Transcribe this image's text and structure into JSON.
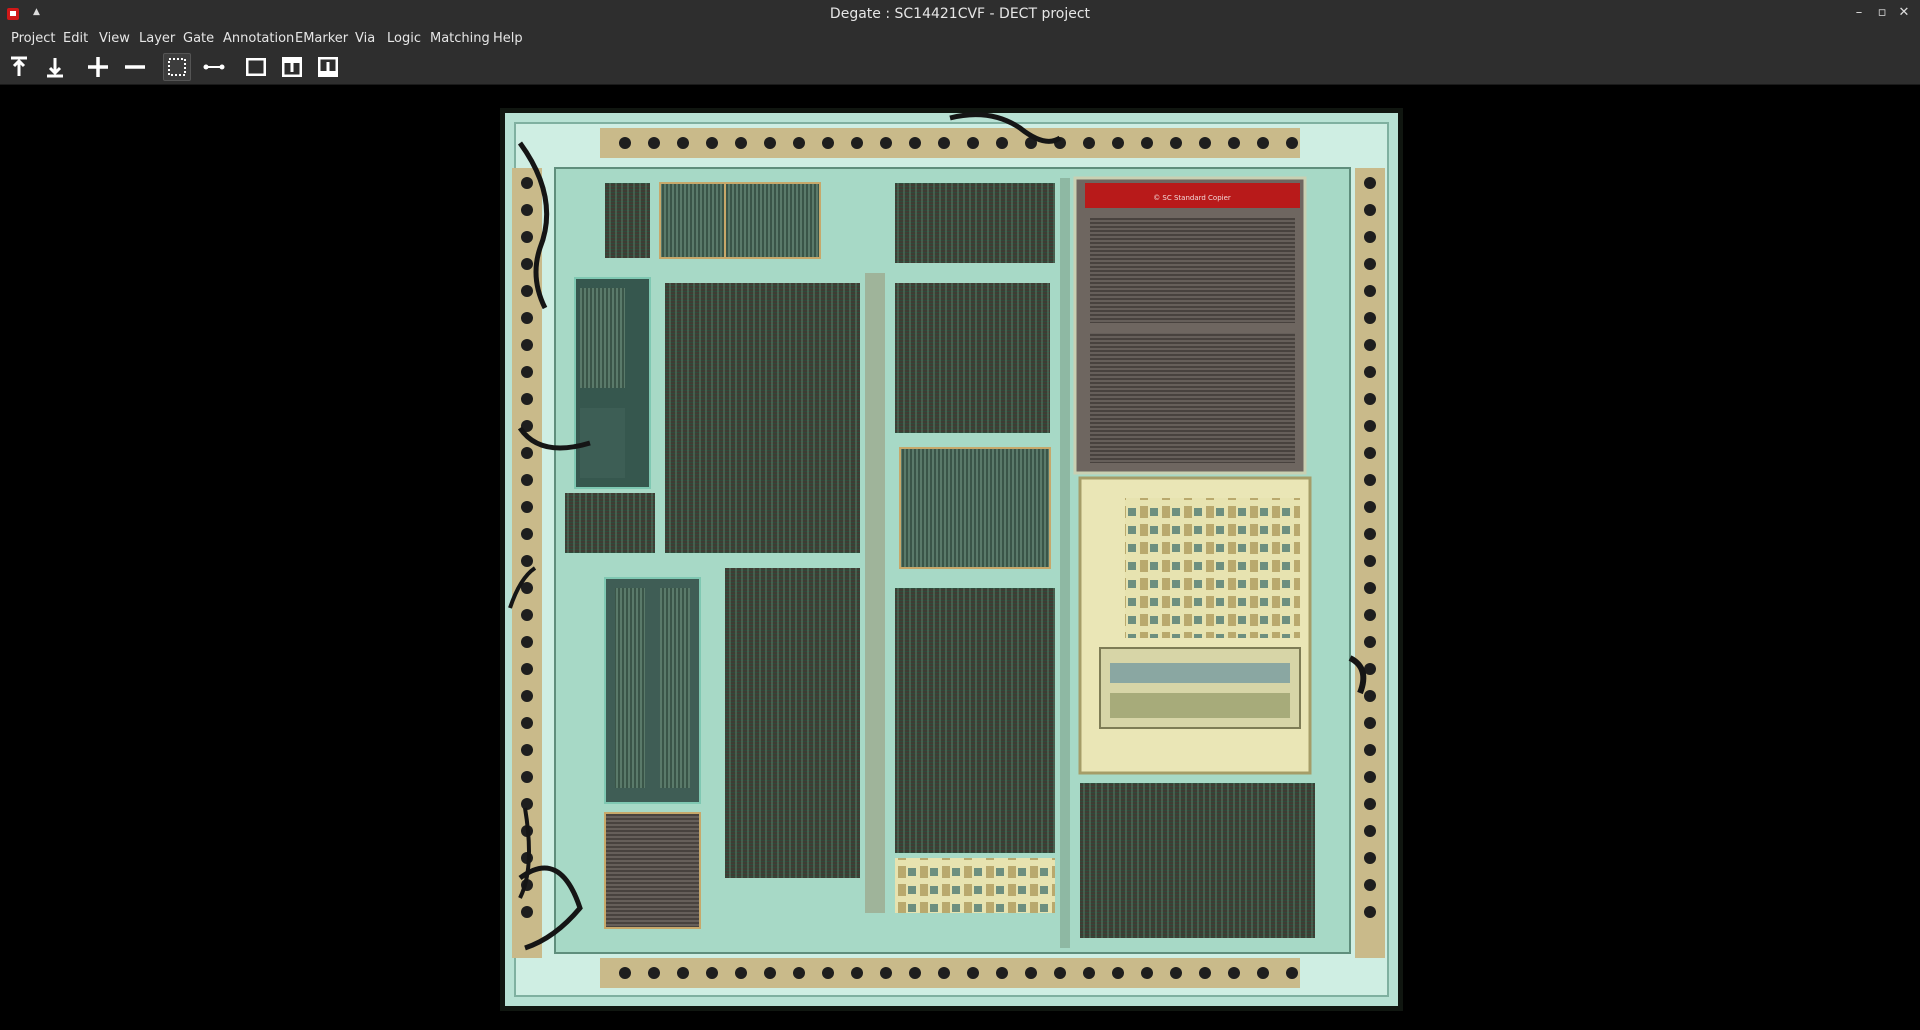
{
  "window": {
    "title": "Degate : SC14421CVF - DECT project",
    "app_icon": "degate-app-icon",
    "controls": [
      {
        "name": "minimize-button",
        "glyph": "–"
      },
      {
        "name": "maximize-button",
        "glyph": "▫"
      },
      {
        "name": "close-button",
        "glyph": "✕"
      }
    ]
  },
  "menu": {
    "items": [
      "Project",
      "Edit",
      "View",
      "Layer",
      "Gate",
      "Annotation",
      "EMarker",
      "Via",
      "Logic",
      "Matching",
      "Help"
    ]
  },
  "toolbar": {
    "tools": [
      {
        "name": "layer-up-button",
        "icon": "arrow-up-icon"
      },
      {
        "name": "layer-down-button",
        "icon": "arrow-down-icon"
      },
      {
        "name": "zoom-in-button",
        "icon": "plus-icon"
      },
      {
        "name": "zoom-out-button",
        "icon": "minus-icon"
      },
      {
        "name": "select-area-button",
        "icon": "dashed-selection-icon",
        "active": true
      },
      {
        "name": "wire-tool-button",
        "icon": "wire-icon"
      },
      {
        "name": "view-mode-1-button",
        "icon": "rectangle-icon"
      },
      {
        "name": "view-mode-2-button",
        "icon": "window-top-icon"
      },
      {
        "name": "view-mode-3-button",
        "icon": "window-bottom-icon"
      }
    ]
  },
  "workspace": {
    "image": "SC14421CVF die micrograph",
    "die_label": "© SC Standard Copier",
    "colors": {
      "background": "#000000",
      "chrome": "#2e2e2e",
      "highlight_block": "#b81a1a"
    }
  }
}
